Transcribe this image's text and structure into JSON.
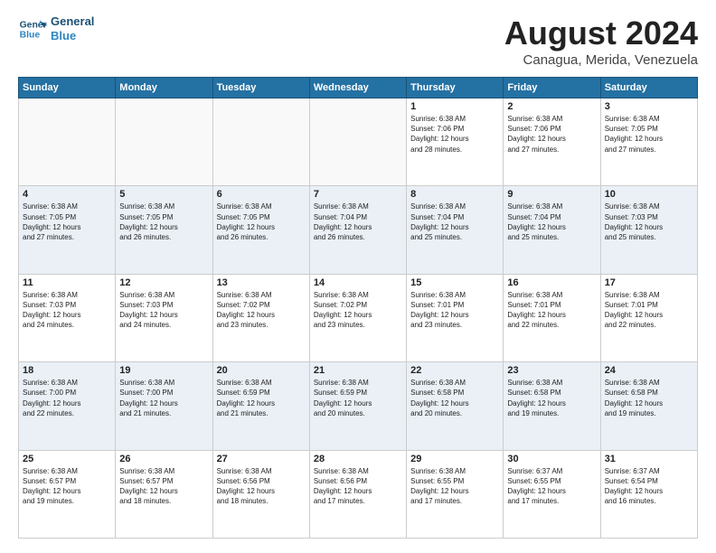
{
  "header": {
    "title": "August 2024",
    "location": "Canagua, Merida, Venezuela",
    "logo_line1": "General",
    "logo_line2": "Blue"
  },
  "weekdays": [
    "Sunday",
    "Monday",
    "Tuesday",
    "Wednesday",
    "Thursday",
    "Friday",
    "Saturday"
  ],
  "weeks": [
    [
      {
        "day": "",
        "info": ""
      },
      {
        "day": "",
        "info": ""
      },
      {
        "day": "",
        "info": ""
      },
      {
        "day": "",
        "info": ""
      },
      {
        "day": "1",
        "info": "Sunrise: 6:38 AM\nSunset: 7:06 PM\nDaylight: 12 hours\nand 28 minutes."
      },
      {
        "day": "2",
        "info": "Sunrise: 6:38 AM\nSunset: 7:06 PM\nDaylight: 12 hours\nand 27 minutes."
      },
      {
        "day": "3",
        "info": "Sunrise: 6:38 AM\nSunset: 7:05 PM\nDaylight: 12 hours\nand 27 minutes."
      }
    ],
    [
      {
        "day": "4",
        "info": "Sunrise: 6:38 AM\nSunset: 7:05 PM\nDaylight: 12 hours\nand 27 minutes."
      },
      {
        "day": "5",
        "info": "Sunrise: 6:38 AM\nSunset: 7:05 PM\nDaylight: 12 hours\nand 26 minutes."
      },
      {
        "day": "6",
        "info": "Sunrise: 6:38 AM\nSunset: 7:05 PM\nDaylight: 12 hours\nand 26 minutes."
      },
      {
        "day": "7",
        "info": "Sunrise: 6:38 AM\nSunset: 7:04 PM\nDaylight: 12 hours\nand 26 minutes."
      },
      {
        "day": "8",
        "info": "Sunrise: 6:38 AM\nSunset: 7:04 PM\nDaylight: 12 hours\nand 25 minutes."
      },
      {
        "day": "9",
        "info": "Sunrise: 6:38 AM\nSunset: 7:04 PM\nDaylight: 12 hours\nand 25 minutes."
      },
      {
        "day": "10",
        "info": "Sunrise: 6:38 AM\nSunset: 7:03 PM\nDaylight: 12 hours\nand 25 minutes."
      }
    ],
    [
      {
        "day": "11",
        "info": "Sunrise: 6:38 AM\nSunset: 7:03 PM\nDaylight: 12 hours\nand 24 minutes."
      },
      {
        "day": "12",
        "info": "Sunrise: 6:38 AM\nSunset: 7:03 PM\nDaylight: 12 hours\nand 24 minutes."
      },
      {
        "day": "13",
        "info": "Sunrise: 6:38 AM\nSunset: 7:02 PM\nDaylight: 12 hours\nand 23 minutes."
      },
      {
        "day": "14",
        "info": "Sunrise: 6:38 AM\nSunset: 7:02 PM\nDaylight: 12 hours\nand 23 minutes."
      },
      {
        "day": "15",
        "info": "Sunrise: 6:38 AM\nSunset: 7:01 PM\nDaylight: 12 hours\nand 23 minutes."
      },
      {
        "day": "16",
        "info": "Sunrise: 6:38 AM\nSunset: 7:01 PM\nDaylight: 12 hours\nand 22 minutes."
      },
      {
        "day": "17",
        "info": "Sunrise: 6:38 AM\nSunset: 7:01 PM\nDaylight: 12 hours\nand 22 minutes."
      }
    ],
    [
      {
        "day": "18",
        "info": "Sunrise: 6:38 AM\nSunset: 7:00 PM\nDaylight: 12 hours\nand 22 minutes."
      },
      {
        "day": "19",
        "info": "Sunrise: 6:38 AM\nSunset: 7:00 PM\nDaylight: 12 hours\nand 21 minutes."
      },
      {
        "day": "20",
        "info": "Sunrise: 6:38 AM\nSunset: 6:59 PM\nDaylight: 12 hours\nand 21 minutes."
      },
      {
        "day": "21",
        "info": "Sunrise: 6:38 AM\nSunset: 6:59 PM\nDaylight: 12 hours\nand 20 minutes."
      },
      {
        "day": "22",
        "info": "Sunrise: 6:38 AM\nSunset: 6:58 PM\nDaylight: 12 hours\nand 20 minutes."
      },
      {
        "day": "23",
        "info": "Sunrise: 6:38 AM\nSunset: 6:58 PM\nDaylight: 12 hours\nand 19 minutes."
      },
      {
        "day": "24",
        "info": "Sunrise: 6:38 AM\nSunset: 6:58 PM\nDaylight: 12 hours\nand 19 minutes."
      }
    ],
    [
      {
        "day": "25",
        "info": "Sunrise: 6:38 AM\nSunset: 6:57 PM\nDaylight: 12 hours\nand 19 minutes."
      },
      {
        "day": "26",
        "info": "Sunrise: 6:38 AM\nSunset: 6:57 PM\nDaylight: 12 hours\nand 18 minutes."
      },
      {
        "day": "27",
        "info": "Sunrise: 6:38 AM\nSunset: 6:56 PM\nDaylight: 12 hours\nand 18 minutes."
      },
      {
        "day": "28",
        "info": "Sunrise: 6:38 AM\nSunset: 6:56 PM\nDaylight: 12 hours\nand 17 minutes."
      },
      {
        "day": "29",
        "info": "Sunrise: 6:38 AM\nSunset: 6:55 PM\nDaylight: 12 hours\nand 17 minutes."
      },
      {
        "day": "30",
        "info": "Sunrise: 6:37 AM\nSunset: 6:55 PM\nDaylight: 12 hours\nand 17 minutes."
      },
      {
        "day": "31",
        "info": "Sunrise: 6:37 AM\nSunset: 6:54 PM\nDaylight: 12 hours\nand 16 minutes."
      }
    ]
  ]
}
